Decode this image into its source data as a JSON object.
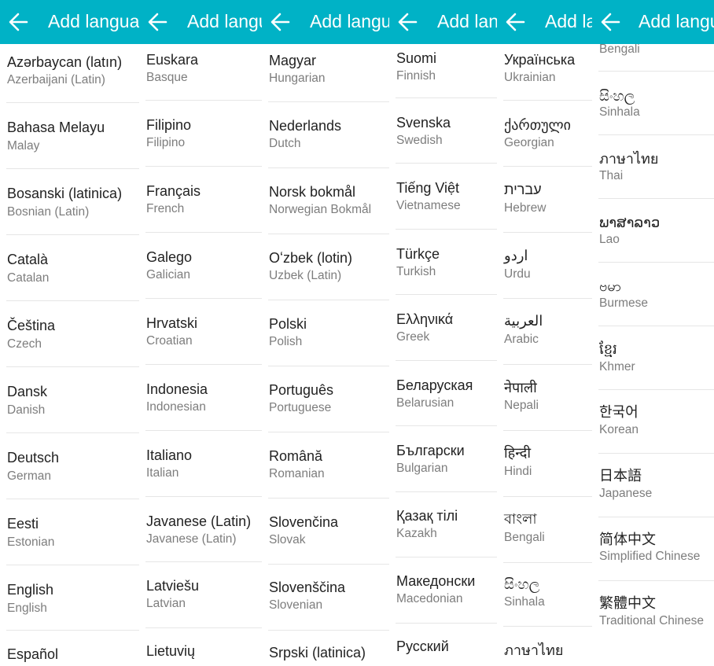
{
  "panels": [
    {
      "title": "Add language",
      "items": [
        {
          "native": "Azərbaycan (latın)",
          "english": "Azerbaijani (Latin)"
        },
        {
          "native": "Bahasa Melayu",
          "english": "Malay"
        },
        {
          "native": "Bosanski (latinica)",
          "english": "Bosnian (Latin)"
        },
        {
          "native": "Català",
          "english": "Catalan"
        },
        {
          "native": "Čeština",
          "english": "Czech"
        },
        {
          "native": "Dansk",
          "english": "Danish"
        },
        {
          "native": "Deutsch",
          "english": "German"
        },
        {
          "native": "Eesti",
          "english": "Estonian"
        },
        {
          "native": "English",
          "english": "English"
        },
        {
          "native": "Español",
          "english": ""
        }
      ]
    },
    {
      "title": "Add language",
      "items": [
        {
          "native": "Euskara",
          "english": "Basque"
        },
        {
          "native": "Filipino",
          "english": "Filipino"
        },
        {
          "native": "Français",
          "english": "French"
        },
        {
          "native": "Galego",
          "english": "Galician"
        },
        {
          "native": "Hrvatski",
          "english": "Croatian"
        },
        {
          "native": "Indonesia",
          "english": "Indonesian"
        },
        {
          "native": "Italiano",
          "english": "Italian"
        },
        {
          "native": "Javanese (Latin)",
          "english": "Javanese (Latin)"
        },
        {
          "native": "Latviešu",
          "english": "Latvian"
        },
        {
          "native": "Lietuvių",
          "english": ""
        }
      ]
    },
    {
      "title": "Add language",
      "items": [
        {
          "native": "Magyar",
          "english": "Hungarian"
        },
        {
          "native": "Nederlands",
          "english": "Dutch"
        },
        {
          "native": "Norsk bokmål",
          "english": "Norwegian Bokmål"
        },
        {
          "native": "Oʻzbek (lotin)",
          "english": "Uzbek (Latin)"
        },
        {
          "native": "Polski",
          "english": "Polish"
        },
        {
          "native": "Português",
          "english": "Portuguese"
        },
        {
          "native": "Română",
          "english": "Romanian"
        },
        {
          "native": "Slovenčina",
          "english": "Slovak"
        },
        {
          "native": "Slovenščina",
          "english": "Slovenian"
        },
        {
          "native": "Srpski (latinica)",
          "english": ""
        }
      ]
    },
    {
      "title": "Add language",
      "items": [
        {
          "native": "Suomi",
          "english": "Finnish"
        },
        {
          "native": "Svenska",
          "english": "Swedish"
        },
        {
          "native": "Tiếng Việt",
          "english": "Vietnamese"
        },
        {
          "native": "Türkçe",
          "english": "Turkish"
        },
        {
          "native": "Ελληνικά",
          "english": "Greek"
        },
        {
          "native": "Беларуская",
          "english": "Belarusian"
        },
        {
          "native": "Български",
          "english": "Bulgarian"
        },
        {
          "native": "Қазақ тілі",
          "english": "Kazakh"
        },
        {
          "native": "Македонски",
          "english": "Macedonian"
        },
        {
          "native": "Русский",
          "english": ""
        }
      ]
    },
    {
      "title": "Add language",
      "items": [
        {
          "native": "Українська",
          "english": "Ukrainian"
        },
        {
          "native": "ქართული",
          "english": "Georgian"
        },
        {
          "native": "עברית",
          "english": "Hebrew"
        },
        {
          "native": "اردو",
          "english": "Urdu"
        },
        {
          "native": "العربية",
          "english": "Arabic"
        },
        {
          "native": "नेपाली",
          "english": "Nepali"
        },
        {
          "native": "हिन्दी",
          "english": "Hindi"
        },
        {
          "native": "বাংলা",
          "english": "Bengali"
        },
        {
          "native": "සිංහල",
          "english": "Sinhala"
        },
        {
          "native": "ภาษาไทย",
          "english": ""
        }
      ]
    },
    {
      "title": "Add language",
      "items": [
        {
          "native": "",
          "english": "Bengali"
        },
        {
          "native": "සිංහල",
          "english": "Sinhala"
        },
        {
          "native": "ภาษาไทย",
          "english": "Thai"
        },
        {
          "native": "ພາສາລາວ",
          "english": "Lao"
        },
        {
          "native": "ဗမာ",
          "english": "Burmese"
        },
        {
          "native": "ខ្មែរ",
          "english": "Khmer"
        },
        {
          "native": "한국어",
          "english": "Korean"
        },
        {
          "native": "日本語",
          "english": "Japanese"
        },
        {
          "native": "简体中文",
          "english": "Simplified Chinese"
        },
        {
          "native": "繁體中文",
          "english": "Traditional Chinese"
        }
      ]
    }
  ],
  "colors": {
    "appbar": "#00b2c6",
    "primary_text": "#222222",
    "secondary_text": "#7d7d7d"
  }
}
